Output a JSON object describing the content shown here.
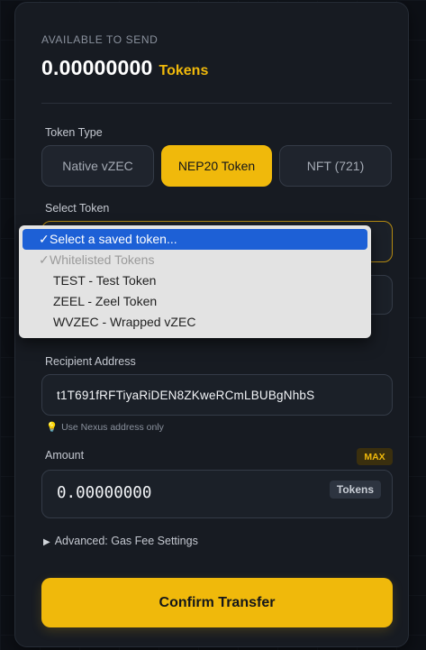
{
  "balance": {
    "label": "AVAILABLE TO SEND",
    "amount": "0.00000000",
    "unit": "Tokens"
  },
  "token_type": {
    "label": "Token Type",
    "options": [
      "Native vZEC",
      "NEP20 Token",
      "NFT (721)"
    ],
    "active": "NEP20 Token"
  },
  "select_token": {
    "label": "Select Token",
    "dropdown": {
      "selected": "Select a saved token...",
      "group_label": "Whitelisted Tokens",
      "options": [
        "TEST - Test Token",
        "ZEEL - Zeel Token",
        "WVZEC - Wrapped vZEC"
      ]
    }
  },
  "recipient": {
    "label": "Recipient Address",
    "value": "t1T691fRFTiyaRiDEN8ZKweRCmLBUBgNhbS",
    "hint": "Use Nexus address only"
  },
  "amount": {
    "label": "Amount",
    "max_label": "MAX",
    "value": "0.00000000",
    "unit_tag": "Tokens"
  },
  "advanced": {
    "label": "Advanced: Gas Fee Settings"
  },
  "confirm_button": {
    "label": "Confirm Transfer"
  },
  "colors": {
    "accent": "#f0b90b",
    "background": "#171b22",
    "selected_option": "#1d60d6"
  }
}
